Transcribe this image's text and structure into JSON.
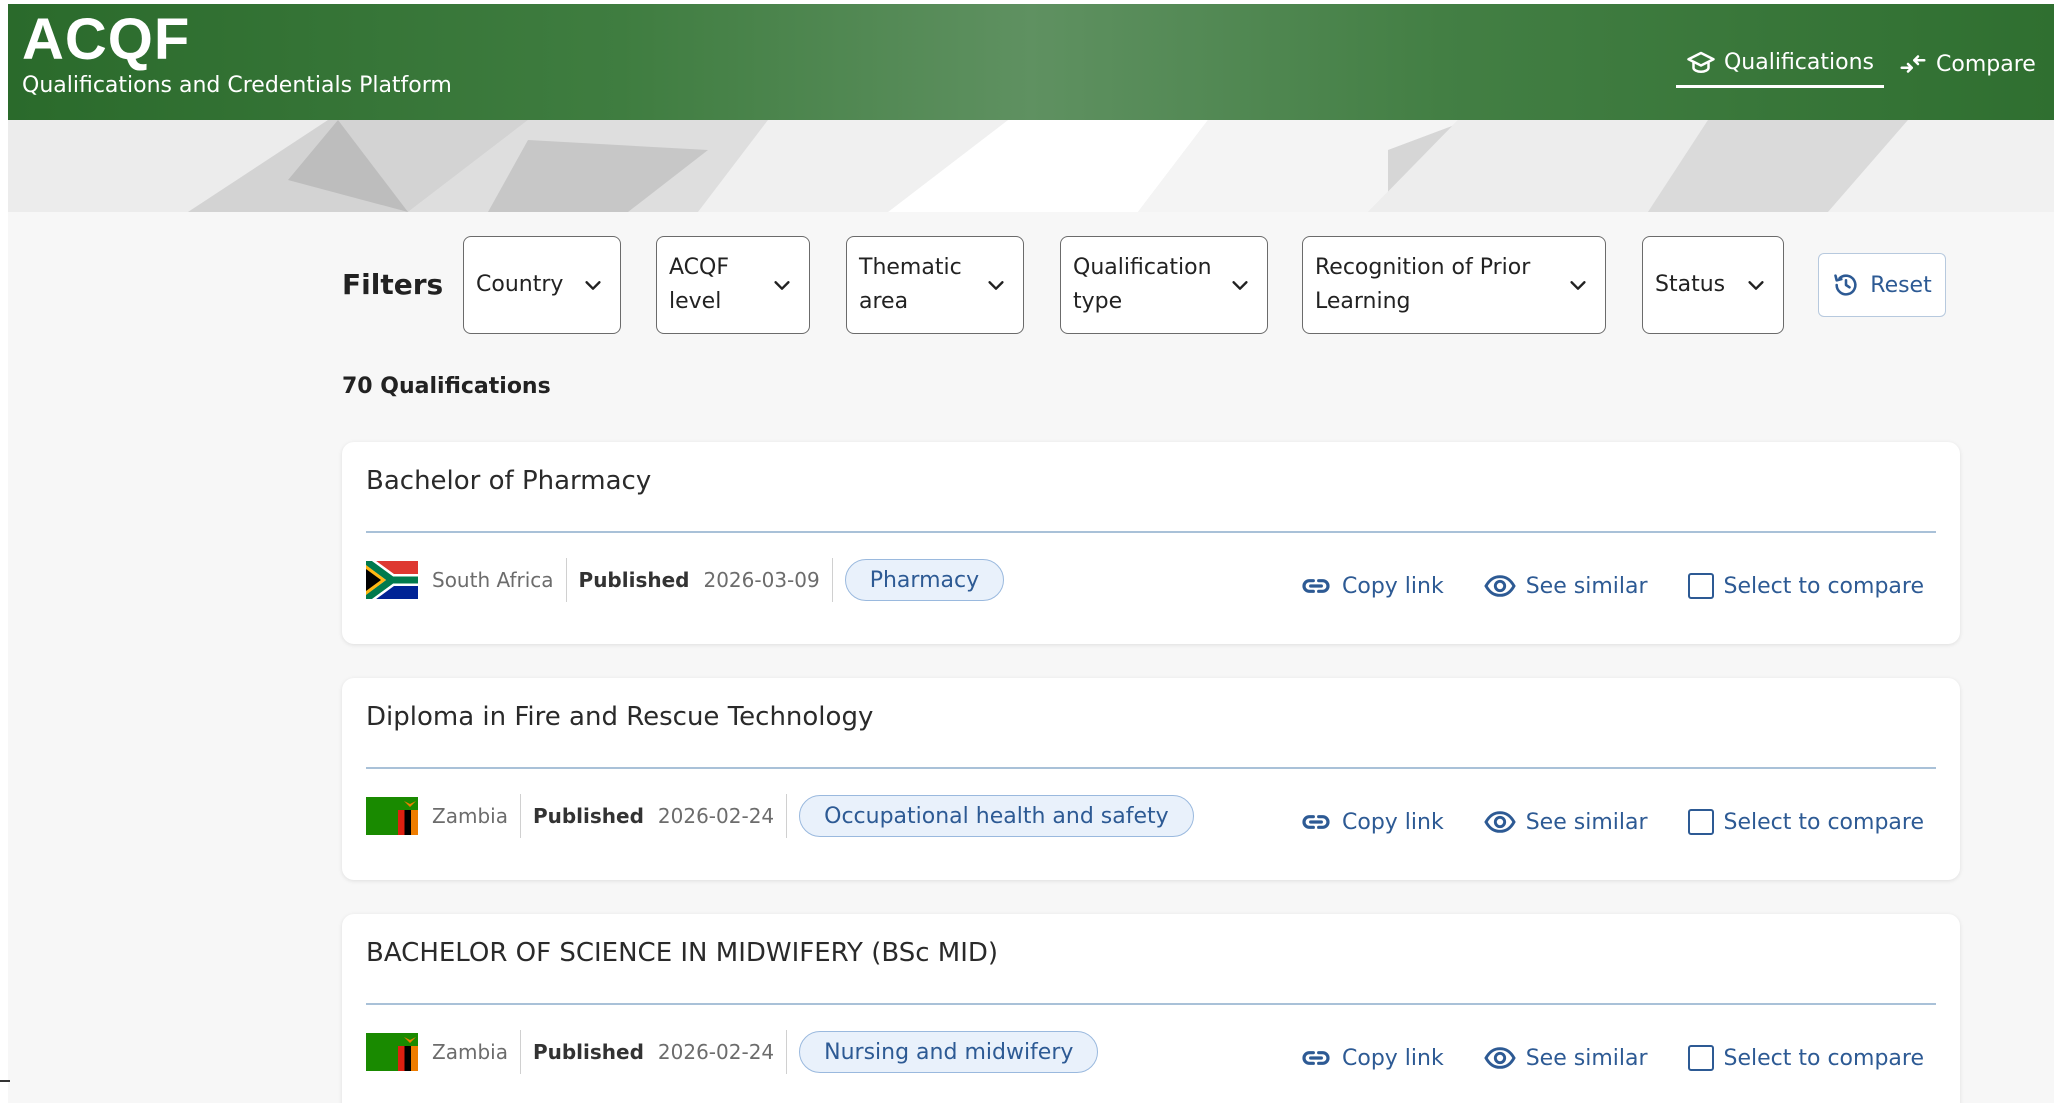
{
  "header": {
    "logo": "ACQF",
    "tagline": "Qualifications and Credentials Platform",
    "nav": [
      {
        "label": "Qualifications",
        "icon": "graduation-cap-icon",
        "active": true
      },
      {
        "label": "Compare",
        "icon": "compare-arrows-icon",
        "active": false
      }
    ]
  },
  "filters": {
    "title": "Filters",
    "items": [
      {
        "label": "Country"
      },
      {
        "label": "ACQF level"
      },
      {
        "label": "Thematic area"
      },
      {
        "label": "Qualification type"
      },
      {
        "label": "Recognition of Prior Learning"
      },
      {
        "label": "Status"
      }
    ],
    "reset_label": "Reset"
  },
  "results": {
    "count_label": "70 Qualifications",
    "items": [
      {
        "title": "Bachelor of Pharmacy",
        "country": "South Africa",
        "flag": "south-africa-flag-icon",
        "published_label": "Published",
        "published_date": "2026-03-09",
        "tag": "Pharmacy"
      },
      {
        "title": "Diploma in Fire and Rescue Technology",
        "country": "Zambia",
        "flag": "zambia-flag-icon",
        "published_label": "Published",
        "published_date": "2026-02-24",
        "tag": "Occupational health and safety"
      },
      {
        "title": "BACHELOR OF SCIENCE IN MIDWIFERY (BSc MID)",
        "country": "Zambia",
        "flag": "zambia-flag-icon",
        "published_label": "Published",
        "published_date": "2026-02-24",
        "tag": "Nursing and midwifery"
      }
    ],
    "actions": {
      "copy_link": "Copy link",
      "see_similar": "See similar",
      "select_compare": "Select to compare"
    }
  },
  "colors": {
    "header_green": "#2f6f30",
    "link_blue": "#2d5a94",
    "tag_bg": "#e9f1fb"
  }
}
